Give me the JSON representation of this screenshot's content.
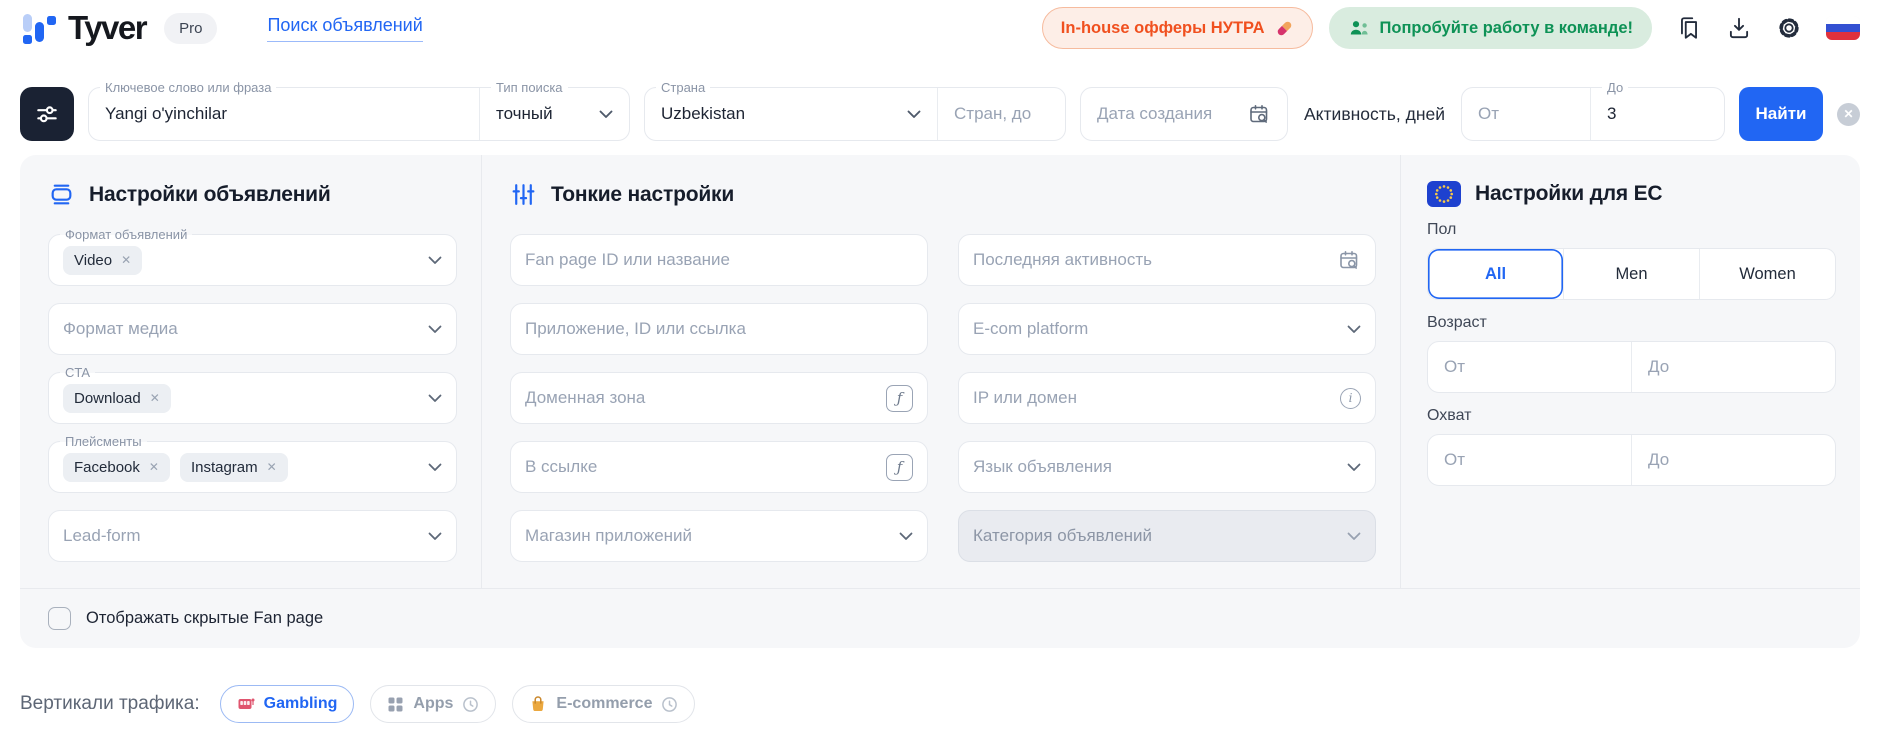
{
  "header": {
    "brand": "Tyver",
    "plan_badge": "Pro",
    "nav_link": "Поиск объявлений",
    "offers_button": "In-house офферы НУТРА",
    "team_button": "Попробуйте работу в команде!"
  },
  "filters_bar": {
    "keyword_label": "Ключевое слово или фраза",
    "keyword_value": "Yangi o'yinchilar",
    "type_label": "Тип поиска",
    "type_value": "точный",
    "country_label": "Страна",
    "country_value": "Uzbekistan",
    "countries_to_placeholder": "Стран, до",
    "date_placeholder": "Дата создания",
    "activity_label": "Активность, дней",
    "activity_from_placeholder": "От",
    "activity_to_label": "До",
    "activity_to_value": "3",
    "search_button": "Найти"
  },
  "ads_settings": {
    "title": "Настройки объявлений",
    "format_label": "Формат объявлений",
    "format_chips": [
      "Video"
    ],
    "media_placeholder": "Формат медиа",
    "cta_label": "CTA",
    "cta_chips": [
      "Download"
    ],
    "placements_label": "Плейсменты",
    "placements_chips": [
      "Facebook",
      "Instagram"
    ],
    "leadform_placeholder": "Lead-form"
  },
  "fine_settings": {
    "title": "Тонкие настройки",
    "fanpage_placeholder": "Fan page ID или название",
    "app_placeholder": "Приложение, ID или ссылка",
    "domain_zone_placeholder": "Доменная зона",
    "in_link_placeholder": "В ссылке",
    "app_store_placeholder": "Магазин приложений",
    "last_activity_placeholder": "Последняя активность",
    "ecom_placeholder": "E-com platform",
    "ip_placeholder": "IP или домен",
    "language_placeholder": "Язык объявления",
    "category_placeholder": "Категория объявлений"
  },
  "eu_settings": {
    "title": "Настройки для ЕС",
    "gender_label": "Пол",
    "gender_options": [
      "All",
      "Men",
      "Women"
    ],
    "gender_selected": "All",
    "age_label": "Возраст",
    "reach_label": "Охват",
    "from_placeholder": "От",
    "to_placeholder": "До"
  },
  "panel_footer": {
    "checkbox_label": "Отображать скрытые Fan page",
    "checkbox_checked": false
  },
  "verticals": {
    "label": "Вертикали трафика:",
    "items": [
      {
        "label": "Gambling",
        "active": true
      },
      {
        "label": "Apps",
        "active": false
      },
      {
        "label": "E-commerce",
        "active": false
      }
    ]
  },
  "glyphs": {
    "remove": "✕",
    "function": "ƒ",
    "info": "i",
    "close": "✕"
  },
  "colors": {
    "accent_blue": "#2166F3",
    "dark_navy": "#1A2233",
    "panel_bg": "#F6F7F9",
    "orange": "#F0501F",
    "green": "#0E9256",
    "flag_blue": "#3350D2",
    "flag_red": "#E0313C"
  }
}
